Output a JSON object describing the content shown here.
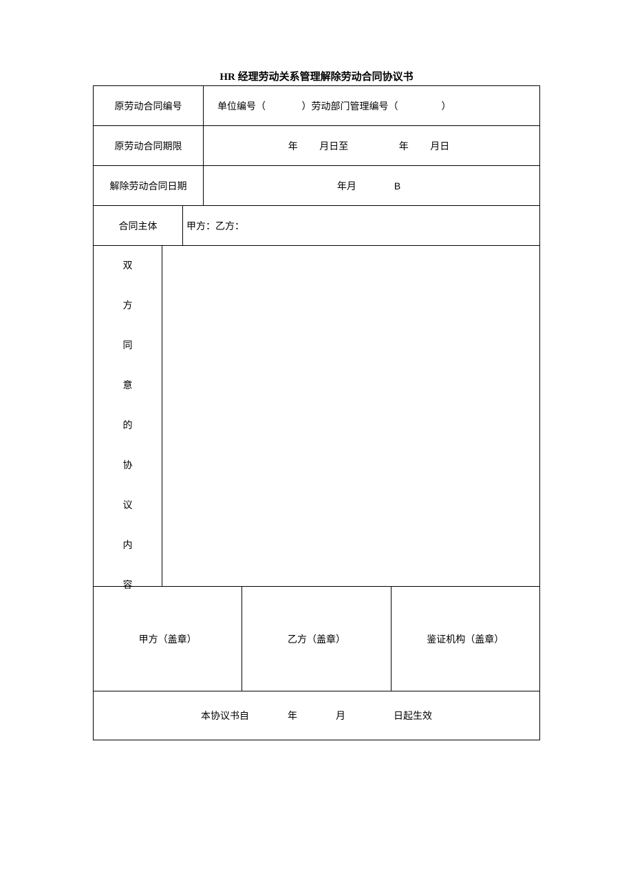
{
  "title": "HR 经理劳动关系管理解除劳动合同协议书",
  "rows": {
    "contractNumber": {
      "label": "原劳动合同编号",
      "value": "单位编号（               ）劳动部门管理编号（                  ）"
    },
    "contractPeriod": {
      "label": "原劳动合同期限",
      "value": "年         月日至                     年         月日"
    },
    "terminationDate": {
      "label": "解除劳动合同日期",
      "valueLeft": "年月",
      "valueRight": "B"
    },
    "parties": {
      "label": "合同主体",
      "value": "甲方：乙方："
    },
    "agreementContent": {
      "c1": "双",
      "c2": "方",
      "c3": "同",
      "c4": "意",
      "c5": "的",
      "c6": "协",
      "c7": "议",
      "c8": "内",
      "c9": "容"
    },
    "stamps": {
      "partyA": "甲方（盖章）",
      "partyB": "乙方（盖章）",
      "notary": "鉴证机构（盖章）"
    },
    "effective": {
      "text": "本协议书自                年                月                    日起生效"
    }
  }
}
